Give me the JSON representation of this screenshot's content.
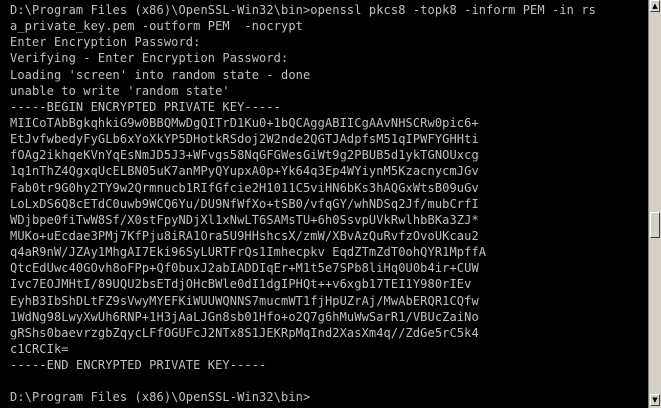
{
  "console": {
    "lines": [
      "D:\\Program Files (x86)\\OpenSSL-Win32\\bin>openssl pkcs8 -topk8 -inform PEM -in rs",
      "a_private_key.pem -outform PEM  -nocrypt",
      "Enter Encryption Password:",
      "Verifying - Enter Encryption Password:",
      "Loading 'screen' into random state - done",
      "unable to write 'random state'",
      "-----BEGIN ENCRYPTED PRIVATE KEY-----",
      "MIICoTAbBgkqhkiG9w0BBQMwDgQITrD1Ku0+1bQCAggABIICgAAvNHSCRw0pic6+",
      "EtJvfwbedyFyGLb6xYoXkYP5DHotkRSdoj2W2nde2QGTJAdpfsM51qIPWFYGHHti",
      "fOAg2ikhqeKVnYqEsNmJD5J3+WFvgs58NqGFGWesGiWt9g2PBUB5d1ykTGNOUxcg",
      "1q1nThZ4QgxqUcELBN05uK7anMPyQYupxA0p+Yk64q3Ep4WYiynM5KzacnycmJGv",
      "Fab0tr9G0hy2TY9w2Qrmnucb1RIfGfcie2H1011C5viHN6bKs3hAQGxWtsB09uGv",
      "LoLxDS6Q8cETdC0uwb9WCQ6Yu/DU9NfWfXo+tSB0/vfqGY/whNDSq2Jf/mubCrfI",
      "WDjbpe0fiTwW8Sf/X0stFpyNDjXl1xNwLT6SAMsTU+6h0SsvpUVkRwlhbBKa3ZJ*",
      "MUKo+uEcdae3PMj7KfPju8iRA1Ora5U9HHshcsX/zmW/XBvAzQuRvfzOvoUKcau2",
      "q4aR9nW/JZAy1MhgAI7Eki96SyLURTFrQs1Imhecpkv EqdZTmZdT0ohQYR1MpffA",
      "QtcEdUwc40GOvh8oFPp+Qf0buxJ2abIADDIqEr+M1t5e7SPb8liHq0U0b4ir+CUW",
      "Ivc7EOJMHtI/89UQU2bsETdjOHcBWle0dI1dgIPHQt++v6xgb17TEI1Y980rIEv",
      "EyhB3IbShDLtFZ9sVwyMYEFKiWUUWQNNS7mucmWT1fjHpUZrAj/MwAbERQR1CQfw",
      "1WdNg98LwyXwUh6RNP+1H3jAaLJGn8sb01Hfo+o2Q7g6hMuWwSarR1/VBUcZaiNo",
      "gRShs0baevrzgbZqycLFfOGUFcJ2NTx8S1JEKRpMqInd2XasXm4q//ZdGe5rC5k4",
      "c1CRCIk=",
      "-----END ENCRYPTED PRIVATE KEY-----",
      "",
      "D:\\Program Files (x86)\\OpenSSL-Win32\\bin>"
    ]
  },
  "scrollbar": {
    "up_arrow_icon": "triangle-up-icon",
    "down_arrow_icon": "triangle-down-icon",
    "up_glyph": "▲",
    "down_glyph": "▼"
  }
}
